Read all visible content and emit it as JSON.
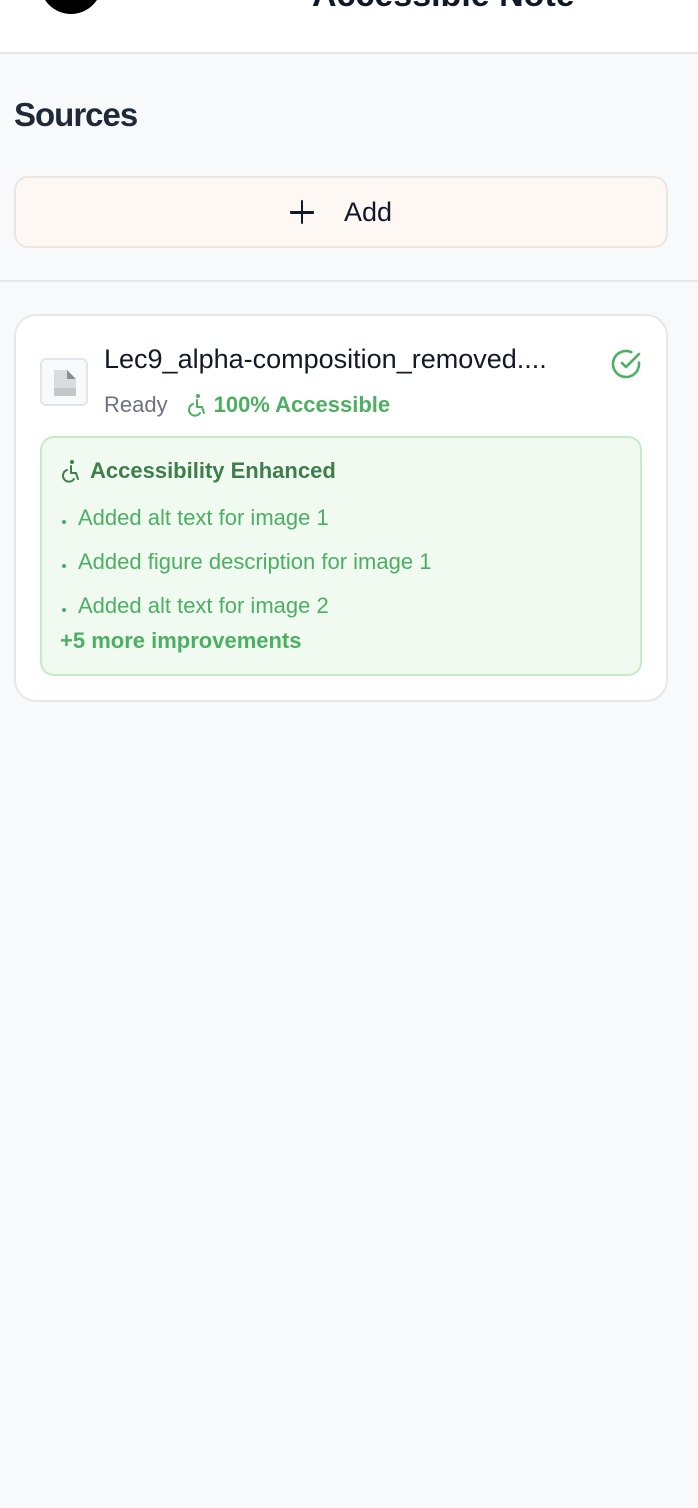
{
  "header": {
    "title_partial": "Accessible Note"
  },
  "sources": {
    "title": "Sources",
    "add_label": "Add"
  },
  "source_item": {
    "file_name": "Lec9_alpha-composition_removed....",
    "status": "Ready",
    "accessibility_score": "100% Accessible",
    "enhancement": {
      "title": "Accessibility Enhanced",
      "items": [
        "Added alt text for image 1",
        "Added figure description for image 1",
        "Added alt text for image 2"
      ],
      "more": "+5 more improvements"
    }
  },
  "colors": {
    "accent_green": "#4caf62",
    "dark_green": "#3f7d4a",
    "add_button_bg": "#fdf8f4",
    "page_bg": "#f8f9fb"
  },
  "icons": {
    "add": "plus-icon",
    "file": "document-icon",
    "accessibility": "accessibility-icon",
    "status": "check-circle-icon"
  }
}
